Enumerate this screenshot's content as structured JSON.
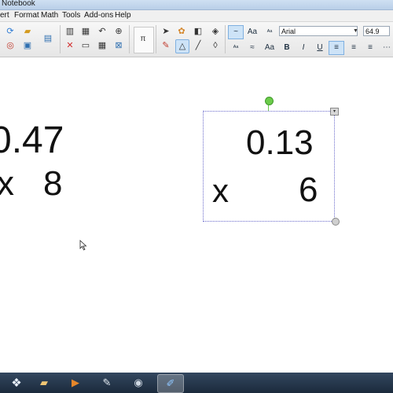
{
  "window": {
    "title": "Notebook"
  },
  "menu": {
    "items": [
      "ert",
      "Format",
      "Math",
      "Tools",
      "Add-ons",
      "Help"
    ]
  },
  "toolbar": {
    "font_name": "Arial",
    "font_size": "64.9",
    "format_labels": {
      "style_aa": "Aa",
      "style_aa2": "Aa",
      "bold": "B",
      "italic": "I",
      "underline": "U"
    }
  },
  "canvas": {
    "left_problem": {
      "number": "0.47",
      "operator": "x",
      "multiplier": "8"
    },
    "right_problem": {
      "number": "0.13",
      "operator": "x",
      "multiplier": "6"
    }
  },
  "colors": {
    "accent": "#3b82d6",
    "selection": "#6a6acb",
    "handle_green": "#6bcb4a"
  }
}
